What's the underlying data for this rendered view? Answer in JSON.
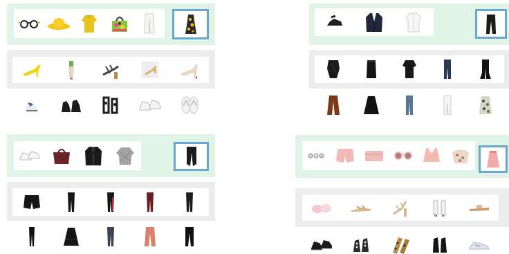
{
  "panels": [
    {
      "id": "top-left",
      "query_items": [
        "sunglasses-icon",
        "sun-hat-icon",
        "yellow-blouse-icon",
        "floral-handbag-icon",
        "white-trousers-icon"
      ],
      "target_item": "floral-dress-icon",
      "candidate_rows": [
        [
          "yellow-heels-icon",
          "bottle-heel-icon",
          "strappy-sandal-icon",
          "tan-sandal-icon",
          "nude-pump-icon"
        ],
        [
          "blue-trainer-icon",
          "black-ankle-boot-icon",
          "black-sandal-icon",
          "white-sneaker-icon",
          "white-flip-flop-icon"
        ]
      ]
    },
    {
      "id": "top-right",
      "query_items": [
        "black-loafer-icon",
        "navy-blazer-icon",
        "white-shirt-icon"
      ],
      "target_item": "black-trousers-icon",
      "candidate_rows": [
        [
          "black-draped-skirt-icon",
          "black-pencil-skirt-icon",
          "black-peplum-skirt-icon",
          "dark-jeans-icon",
          "black-flared-pants-icon"
        ],
        [
          "rust-wide-pants-icon",
          "black-a-line-skirt-icon",
          "light-jeans-icon",
          "white-jeans-icon",
          "floral-skirt-icon"
        ]
      ]
    },
    {
      "id": "bottom-left",
      "query_items": [
        "white-sneakers-icon",
        "burgundy-tote-icon",
        "black-leather-jacket-icon",
        "grey-knit-sweater-icon"
      ],
      "target_item": "black-joggers-icon",
      "candidate_rows": [
        [
          "black-shorts-icon",
          "black-skinny-pants-icon",
          "black-red-stripe-pants-icon",
          "burgundy-pants-icon",
          "black-slim-pants-icon"
        ],
        [
          "black-leggings-icon",
          "black-ruffle-skirt-icon",
          "grey-skinny-jeans-icon",
          "coral-trousers-icon",
          "black-straight-pants-icon"
        ]
      ]
    },
    {
      "id": "bottom-right",
      "query_items": [
        "pearl-earrings-icon",
        "pink-shorts-icon",
        "pink-clutch-icon",
        "pink-sunglasses-icon",
        "pink-crop-top-icon",
        "floral-scarf-icon"
      ],
      "target_item": "pink-skirt-icon",
      "candidate_rows": [
        [
          "pink-slipper-icon",
          "tan-flat-sandal-icon",
          "nude-heel-sandal-icon",
          "clear-heel-icon",
          "tan-slide-icon"
        ],
        [
          "black-sneaker-icon",
          "studded-brogue-icon",
          "leopard-flat-icon",
          "black-booties-icon",
          "silver-sneaker-icon"
        ]
      ]
    }
  ],
  "colors": {
    "query_band": "#dff3e6",
    "candidate_band": "#ececec",
    "target_border": "#6aa7cf"
  }
}
